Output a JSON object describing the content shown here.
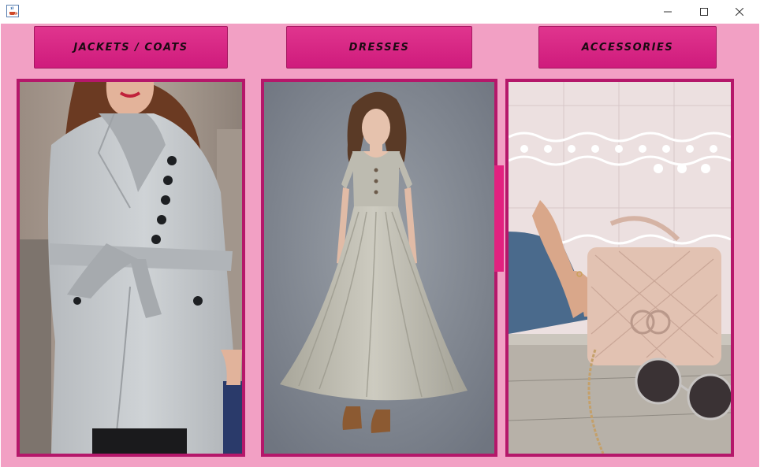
{
  "window": {
    "app_icon": "java-coffee-cup-icon",
    "controls": [
      "minimize-icon",
      "maximize-icon",
      "close-icon"
    ]
  },
  "categories": [
    {
      "label": "JACKETS / COATS"
    },
    {
      "label": "DRESSES"
    },
    {
      "label": "ACCESSORIES"
    }
  ],
  "colors": {
    "background": "#f2a0c4",
    "button": "#d8247f",
    "panel_border": "#b5176a",
    "button_text": "#1b0a12"
  }
}
